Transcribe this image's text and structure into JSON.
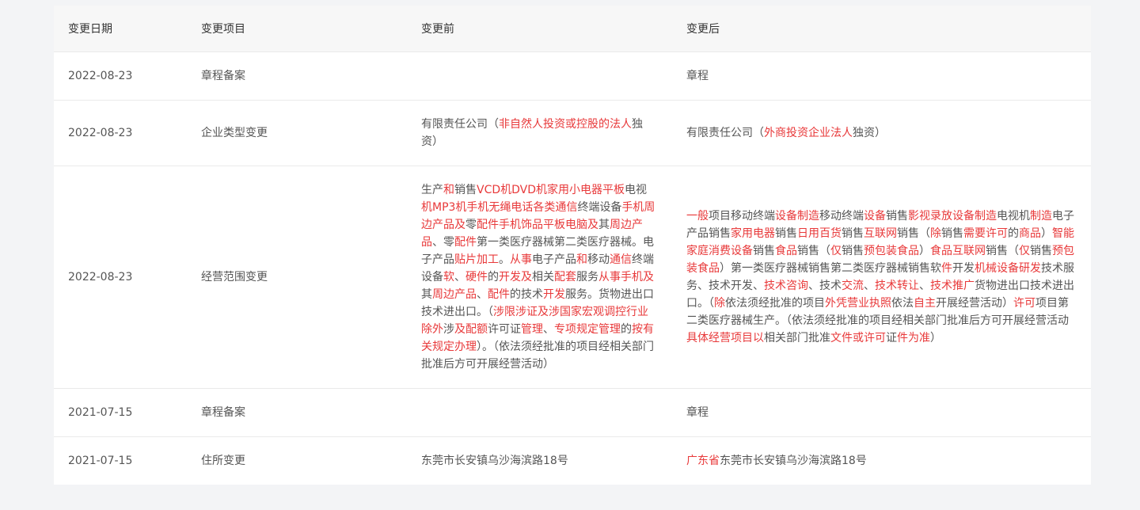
{
  "headers": [
    "变更日期",
    "变更项目",
    "变更前",
    "变更后"
  ],
  "colors": {
    "highlight": "#e8393a",
    "text": "#555555"
  },
  "rows": [
    {
      "date": "2022-08-23",
      "item": "章程备案",
      "before": [],
      "after": [
        {
          "t": "章程",
          "hl": false
        }
      ]
    },
    {
      "date": "2022-08-23",
      "item": "企业类型变更",
      "before": [
        {
          "t": "有限责任公司（",
          "hl": false
        },
        {
          "t": "非自然人投资或控股的法人",
          "hl": true
        },
        {
          "t": "独资）",
          "hl": false
        }
      ],
      "after": [
        {
          "t": "有限责任公司（",
          "hl": false
        },
        {
          "t": "外商投资企业法人",
          "hl": true
        },
        {
          "t": "独资）",
          "hl": false
        }
      ]
    },
    {
      "date": "2022-08-23",
      "item": "经营范围变更",
      "before": [
        {
          "t": "生产",
          "hl": false
        },
        {
          "t": "和",
          "hl": true
        },
        {
          "t": "销售",
          "hl": false
        },
        {
          "t": "VCD机DVD机家用小电器平板",
          "hl": true
        },
        {
          "t": "电视",
          "hl": false
        },
        {
          "t": "机MP3机手机无绳电话各类通信",
          "hl": true
        },
        {
          "t": "终端设备",
          "hl": false
        },
        {
          "t": "手机周边产品及",
          "hl": true
        },
        {
          "t": "零",
          "hl": false
        },
        {
          "t": "配件手机饰品平板电脑及",
          "hl": true
        },
        {
          "t": "其",
          "hl": false
        },
        {
          "t": "周边产品",
          "hl": true
        },
        {
          "t": "、零",
          "hl": false
        },
        {
          "t": "配件",
          "hl": true
        },
        {
          "t": "第一类医疗器械第二类医疗器械。电子产品",
          "hl": false
        },
        {
          "t": "贴片加工",
          "hl": true
        },
        {
          "t": "。",
          "hl": false
        },
        {
          "t": "从事",
          "hl": true
        },
        {
          "t": "电子产品",
          "hl": false
        },
        {
          "t": "和",
          "hl": true
        },
        {
          "t": "移动",
          "hl": false
        },
        {
          "t": "通信",
          "hl": true
        },
        {
          "t": "终端设备",
          "hl": false
        },
        {
          "t": "软",
          "hl": true
        },
        {
          "t": "、",
          "hl": false
        },
        {
          "t": "硬件",
          "hl": true
        },
        {
          "t": "的",
          "hl": false
        },
        {
          "t": "开发及",
          "hl": true
        },
        {
          "t": "相关",
          "hl": false
        },
        {
          "t": "配套",
          "hl": true
        },
        {
          "t": "服务",
          "hl": false
        },
        {
          "t": "从事手机及",
          "hl": true
        },
        {
          "t": "其",
          "hl": false
        },
        {
          "t": "周边产品",
          "hl": true
        },
        {
          "t": "、",
          "hl": false
        },
        {
          "t": "配件",
          "hl": true
        },
        {
          "t": "的技术",
          "hl": false
        },
        {
          "t": "开发",
          "hl": true
        },
        {
          "t": "服务。货物进出口技术进出口。（",
          "hl": false
        },
        {
          "t": "涉限涉证及涉国家宏观调控行业除外",
          "hl": true
        },
        {
          "t": "涉",
          "hl": false
        },
        {
          "t": "及配额",
          "hl": true
        },
        {
          "t": "许可证",
          "hl": false
        },
        {
          "t": "管理",
          "hl": true
        },
        {
          "t": "、",
          "hl": false
        },
        {
          "t": "专项规定管理",
          "hl": true
        },
        {
          "t": "的",
          "hl": false
        },
        {
          "t": "按有关规定办理",
          "hl": true
        },
        {
          "t": "）。（依法须经批准的项目经相关部门批准后方可开展经营活动）",
          "hl": false
        }
      ],
      "after": [
        {
          "t": "一般",
          "hl": true
        },
        {
          "t": "项目移动终端",
          "hl": false
        },
        {
          "t": "设备制造",
          "hl": true
        },
        {
          "t": "移动终端",
          "hl": false
        },
        {
          "t": "设备",
          "hl": true
        },
        {
          "t": "销售",
          "hl": false
        },
        {
          "t": "影视录放设备制造",
          "hl": true
        },
        {
          "t": "电视机",
          "hl": false
        },
        {
          "t": "制造",
          "hl": true
        },
        {
          "t": "电子产品销售",
          "hl": false
        },
        {
          "t": "家用电器",
          "hl": true
        },
        {
          "t": "销售",
          "hl": false
        },
        {
          "t": "日用百货",
          "hl": true
        },
        {
          "t": "销售",
          "hl": false
        },
        {
          "t": "互联网",
          "hl": true
        },
        {
          "t": "销售（",
          "hl": false
        },
        {
          "t": "除",
          "hl": true
        },
        {
          "t": "销售",
          "hl": false
        },
        {
          "t": "需要许可",
          "hl": true
        },
        {
          "t": "的",
          "hl": false
        },
        {
          "t": "商品",
          "hl": true
        },
        {
          "t": "）",
          "hl": false
        },
        {
          "t": "智能家庭消费设备",
          "hl": true
        },
        {
          "t": "销售",
          "hl": false
        },
        {
          "t": "食品",
          "hl": true
        },
        {
          "t": "销售（",
          "hl": false
        },
        {
          "t": "仅",
          "hl": true
        },
        {
          "t": "销售",
          "hl": false
        },
        {
          "t": "预包装食品",
          "hl": true
        },
        {
          "t": "）",
          "hl": false
        },
        {
          "t": "食品互联网",
          "hl": true
        },
        {
          "t": "销售（",
          "hl": false
        },
        {
          "t": "仅",
          "hl": true
        },
        {
          "t": "销售",
          "hl": false
        },
        {
          "t": "预包装食品",
          "hl": true
        },
        {
          "t": "）第一类医疗器械销售第二类医疗器械销售软",
          "hl": false
        },
        {
          "t": "件",
          "hl": true
        },
        {
          "t": "开发",
          "hl": false
        },
        {
          "t": "机械设备研发",
          "hl": true
        },
        {
          "t": "技术服务、技术开发、",
          "hl": false
        },
        {
          "t": "技术咨询",
          "hl": true
        },
        {
          "t": "、技术",
          "hl": false
        },
        {
          "t": "交流",
          "hl": true
        },
        {
          "t": "、",
          "hl": false
        },
        {
          "t": "技术转让",
          "hl": true
        },
        {
          "t": "、",
          "hl": false
        },
        {
          "t": "技术推广",
          "hl": true
        },
        {
          "t": "货物进出口技术进出口。（",
          "hl": false
        },
        {
          "t": "除",
          "hl": true
        },
        {
          "t": "依法须经批准的项目",
          "hl": false
        },
        {
          "t": "外凭营业执照",
          "hl": true
        },
        {
          "t": "依法",
          "hl": false
        },
        {
          "t": "自主",
          "hl": true
        },
        {
          "t": "开展经营活动）",
          "hl": false
        },
        {
          "t": "许可",
          "hl": true
        },
        {
          "t": "项目第二类医疗器械生产。（依法须经批准的项目经相关部门批准后方可开展经营活动",
          "hl": false
        },
        {
          "t": "具体经营项目以",
          "hl": true
        },
        {
          "t": "相关部门批准",
          "hl": false
        },
        {
          "t": "文件或许可",
          "hl": true
        },
        {
          "t": "证",
          "hl": false
        },
        {
          "t": "件为准",
          "hl": true
        },
        {
          "t": "）",
          "hl": false
        }
      ]
    },
    {
      "date": "2021-07-15",
      "item": "章程备案",
      "before": [],
      "after": [
        {
          "t": "章程",
          "hl": false
        }
      ]
    },
    {
      "date": "2021-07-15",
      "item": "住所变更",
      "before": [
        {
          "t": "东莞市长安镇乌沙海滨路18号",
          "hl": false
        }
      ],
      "after": [
        {
          "t": "广东省",
          "hl": true
        },
        {
          "t": "东莞市长安镇乌沙海滨路18号",
          "hl": false
        }
      ]
    }
  ]
}
